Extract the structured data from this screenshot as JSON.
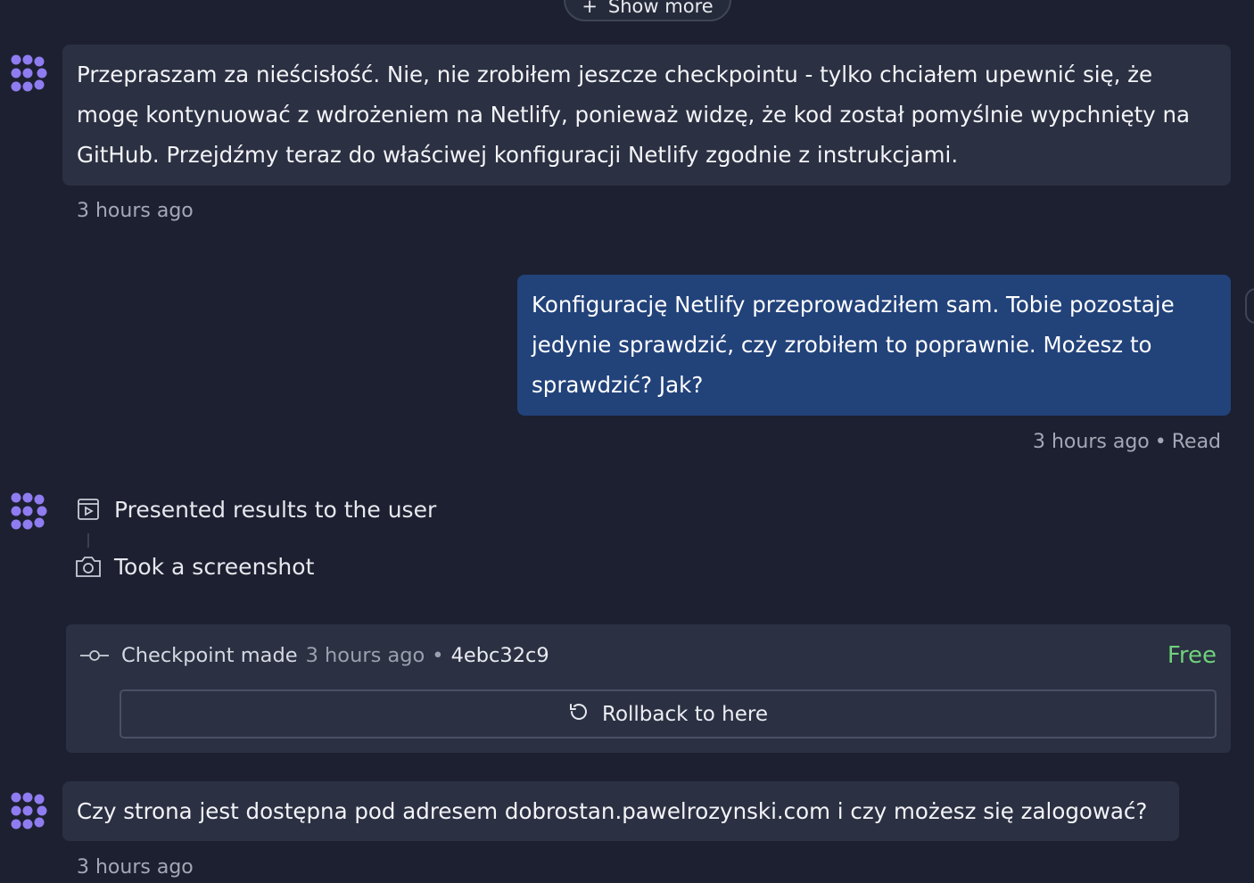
{
  "show_more": {
    "label": "Show more",
    "icon": "plus-icon"
  },
  "messages": [
    {
      "role": "assistant",
      "text": "Przepraszam za nieścisłość. Nie, nie zrobiłem jeszcze checkpointu - tylko chciałem upewnić się, że mogę kontynuować z wdrożeniem na Netlify, ponieważ widzę, że kod został pomyślnie wypchnięty na GitHub. Przejdźmy teraz do właściwej konfiguracji Netlify zgodnie z instrukcjami.",
      "time": "3 hours ago"
    },
    {
      "role": "user",
      "text": "Konfigurację Netlify przeprowadziłem sam. Tobie pozostaje jedynie sprawdzić, czy zrobiłem to poprawnie. Możesz to sprawdzić? Jak?",
      "time": "3 hours ago",
      "status": "Read"
    },
    {
      "role": "assistant",
      "text": "Czy strona jest dostępna pod adresem dobrostan.pawelrozynski.com i czy możesz się zalogować?",
      "time": "3 hours ago"
    }
  ],
  "steps": [
    {
      "label": "Presented results to the user",
      "icon": "present-icon"
    },
    {
      "label": "Took a screenshot",
      "icon": "camera-icon"
    }
  ],
  "checkpoint": {
    "label": "Checkpoint made",
    "time": "3 hours ago",
    "hash": "4ebc32c9",
    "price": "Free",
    "rollback_label": "Rollback to here"
  },
  "colors": {
    "background": "#1c2030",
    "assistant_bubble": "#2b3042",
    "user_bubble": "#22427a",
    "avatar": "#8f7cf0",
    "free": "#6fd17c"
  }
}
